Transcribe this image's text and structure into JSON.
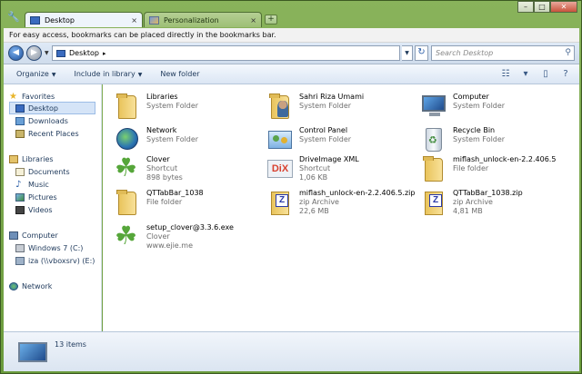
{
  "tabs": [
    {
      "label": "Desktop",
      "close": "×"
    },
    {
      "label": "Personalization",
      "close": "×"
    }
  ],
  "new_tab_glyph": "+",
  "window_buttons": {
    "minimize": "–",
    "maximize": "□",
    "close": "✕"
  },
  "bookmark_bar_text": "For easy access, bookmarks can be placed directly in the bookmarks bar.",
  "address": {
    "location": "Desktop",
    "separator": "▸",
    "search_placeholder": "Search Desktop"
  },
  "commands": [
    {
      "label": "Organize",
      "has_dropdown": true
    },
    {
      "label": "Include in library",
      "has_dropdown": true
    },
    {
      "label": "New folder",
      "has_dropdown": false
    }
  ],
  "nav_pane": {
    "favorites": {
      "label": "Favorites",
      "items": [
        "Desktop",
        "Downloads",
        "Recent Places"
      ],
      "selected": "Desktop"
    },
    "libraries": {
      "label": "Libraries",
      "items": [
        "Documents",
        "Music",
        "Pictures",
        "Videos"
      ]
    },
    "computer": {
      "label": "Computer",
      "items": [
        "Windows 7 (C:)",
        "iza (\\\\vboxsrv) (E:)"
      ]
    },
    "network": {
      "label": "Network"
    }
  },
  "items": [
    {
      "name": "Libraries",
      "line2": "System Folder",
      "line3": "",
      "icon": "libraries-folder-icon"
    },
    {
      "name": "Sahri Riza Umami",
      "line2": "System Folder",
      "line3": "",
      "icon": "user-folder-icon"
    },
    {
      "name": "Computer",
      "line2": "System Folder",
      "line3": "",
      "icon": "computer-icon"
    },
    {
      "name": "Network",
      "line2": "System Folder",
      "line3": "",
      "icon": "network-icon"
    },
    {
      "name": "Control Panel",
      "line2": "System Folder",
      "line3": "",
      "icon": "control-panel-icon"
    },
    {
      "name": "Recycle Bin",
      "line2": "System Folder",
      "line3": "",
      "icon": "recycle-bin-icon"
    },
    {
      "name": "Clover",
      "line2": "Shortcut",
      "line3": "898 bytes",
      "icon": "clover-icon"
    },
    {
      "name": "DriveImage XML",
      "line2": "Shortcut",
      "line3": "1,06 KB",
      "icon": "driveimage-icon"
    },
    {
      "name": "miflash_unlock-en-2.2.406.5",
      "line2": "File folder",
      "line3": "",
      "icon": "folder-icon"
    },
    {
      "name": "QTTabBar_1038",
      "line2": "File folder",
      "line3": "",
      "icon": "folder-icon"
    },
    {
      "name": "miflash_unlock-en-2.2.406.5.zip",
      "line2": "zip Archive",
      "line3": "22,6 MB",
      "icon": "zip-icon"
    },
    {
      "name": "QTTabBar_1038.zip",
      "line2": "zip Archive",
      "line3": "4,81 MB",
      "icon": "zip-icon"
    },
    {
      "name": "setup_clover@3.3.6.exe",
      "line2": "Clover",
      "line3": "www.ejie.me",
      "icon": "clover-setup-icon"
    }
  ],
  "status": {
    "item_count": "13 items"
  }
}
